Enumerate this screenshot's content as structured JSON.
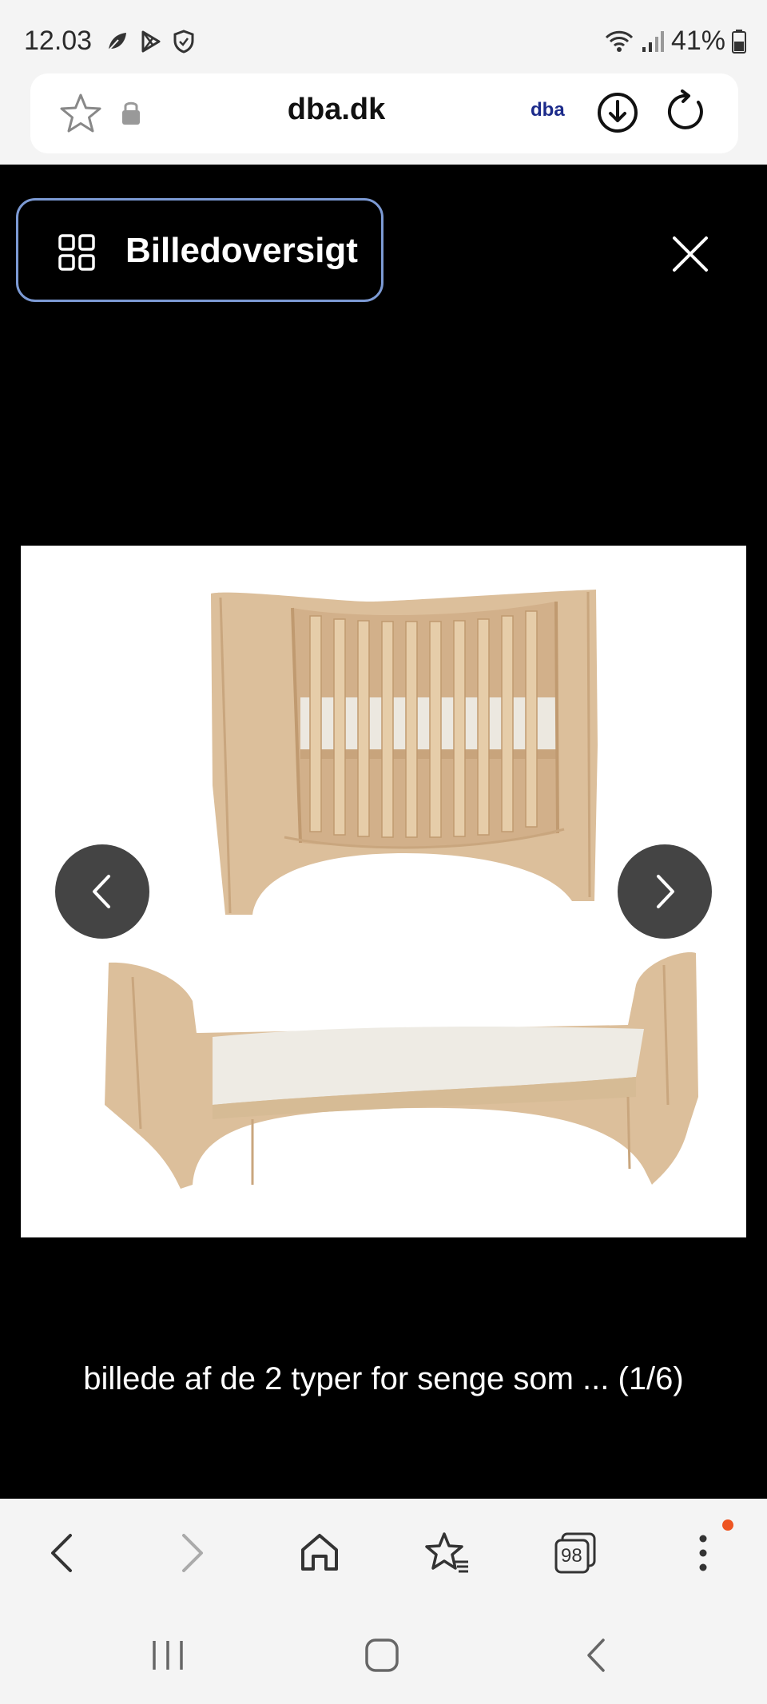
{
  "status_bar": {
    "time": "12.03",
    "battery": "41%"
  },
  "browser": {
    "url": "dba.dk",
    "site_badge": "dba"
  },
  "gallery": {
    "overview_label": "Billedoversigt",
    "caption": "billede af de 2 typer for senge som ... (1/6)",
    "image_subject": "crib-and-junior-bed-photo"
  },
  "toolbar": {
    "tab_count": "98"
  },
  "colors": {
    "background": "#000000",
    "chrome": "#f4f4f4",
    "accent_border": "#7c9ad4",
    "nav_button": "#444444",
    "notification_dot": "#ee5522",
    "brand": "#1b2a8a",
    "wood": "#d8b893"
  }
}
